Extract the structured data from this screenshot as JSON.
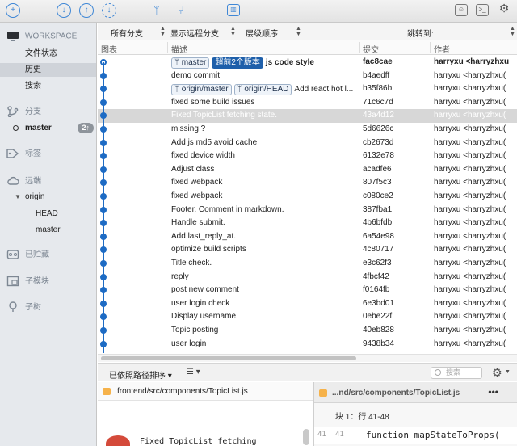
{
  "window": {
    "accent": "#1d6bc4"
  },
  "toolbar": {
    "icons": [
      "add-icon",
      "pull-icon",
      "push-icon",
      "fetch-icon",
      "branch-icon",
      "merge-icon",
      "stash-icon",
      "finder-icon",
      "terminal-icon",
      "settings-icon"
    ]
  },
  "sidebar": {
    "workspace": "WORKSPACE",
    "workspace_items": [
      "文件状态",
      "历史",
      "搜索"
    ],
    "branches": "分支",
    "current_branch": "master",
    "current_badge": "2↑",
    "tags": "标签",
    "remotes": "远端",
    "remote_origin": "origin",
    "remote_branches": [
      "HEAD",
      "master"
    ],
    "stashes": "已贮藏",
    "submodules": "子模块",
    "subtrees": "子树"
  },
  "filter": {
    "branches": "所有分支",
    "remote": "显示远程分支",
    "order": "层级顺序",
    "jump": "跳转到:"
  },
  "table": {
    "headers": {
      "graph": "图表",
      "desc": "描述",
      "commit": "提交",
      "author": "作者"
    },
    "head_tags": {
      "branch": "master",
      "ahead": "超前2个版本"
    },
    "origin_tags": [
      "origin/master",
      "origin/HEAD"
    ],
    "rows": [
      {
        "desc": "js code style",
        "hash": "fac8cae",
        "author": "harryxu <harryzhxu"
      },
      {
        "desc": "demo commit",
        "hash": "b4aedff",
        "author": "harryxu <harryzhxu("
      },
      {
        "desc": "Add react hot l...",
        "hash": "b35f86b",
        "author": "harryxu <harryzhxu("
      },
      {
        "desc": "fixed some build issues",
        "hash": "71c6c7d",
        "author": "harryxu <harryzhxu("
      },
      {
        "desc": "Fixed TopicList fetching state.",
        "hash": "43a4d12",
        "author": "harryxu <harryzhxu("
      },
      {
        "desc": "missing ?",
        "hash": "5d6626c",
        "author": "harryxu <harryzhxu("
      },
      {
        "desc": "Add js md5 avoid cache.",
        "hash": "cb2673d",
        "author": "harryxu <harryzhxu("
      },
      {
        "desc": "fixed device width",
        "hash": "6132e78",
        "author": "harryxu <harryzhxu("
      },
      {
        "desc": "Adjust class",
        "hash": "acadfe6",
        "author": "harryxu <harryzhxu("
      },
      {
        "desc": "fixed webpack",
        "hash": "807f5c3",
        "author": "harryxu <harryzhxu("
      },
      {
        "desc": "fixed webpack",
        "hash": "c080ce2",
        "author": "harryxu <harryzhxu("
      },
      {
        "desc": "Footer. Comment in markdown.",
        "hash": "387fba1",
        "author": "harryxu <harryzhxu("
      },
      {
        "desc": "Handle submit.",
        "hash": "4b6bfdb",
        "author": "harryxu <harryzhxu("
      },
      {
        "desc": "Add last_reply_at.",
        "hash": "6a54e98",
        "author": "harryxu <harryzhxu("
      },
      {
        "desc": "optimize build scripts",
        "hash": "4c80717",
        "author": "harryxu <harryzhxu("
      },
      {
        "desc": "Title check.",
        "hash": "e3c62f3",
        "author": "harryxu <harryzhxu("
      },
      {
        "desc": "reply",
        "hash": "4fbcf42",
        "author": "harryxu <harryzhxu("
      },
      {
        "desc": "post new comment",
        "hash": "f0164fb",
        "author": "harryxu <harryzhxu("
      },
      {
        "desc": "user login check",
        "hash": "6e3bd01",
        "author": "harryxu <harryzhxu("
      },
      {
        "desc": "Display username.",
        "hash": "0ebe22f",
        "author": "harryxu <harryzhxu("
      },
      {
        "desc": "Topic posting",
        "hash": "40eb828",
        "author": "harryxu <harryzhxu("
      },
      {
        "desc": "user login",
        "hash": "9438b34",
        "author": "harryxu <harryzhxu("
      }
    ]
  },
  "bottom": {
    "sort": "已依照路径排序",
    "search_placeholder": "搜索",
    "file": "frontend/src/components/TopicList.js",
    "commit_msg": "Fixed TopicList fetching",
    "diff_title": "...nd/src/components/TopicList.js",
    "more": "•••",
    "hunk": "块 1：行 41-48",
    "line_old": "41",
    "line_new": "41",
    "code": "function mapStateToProps("
  }
}
